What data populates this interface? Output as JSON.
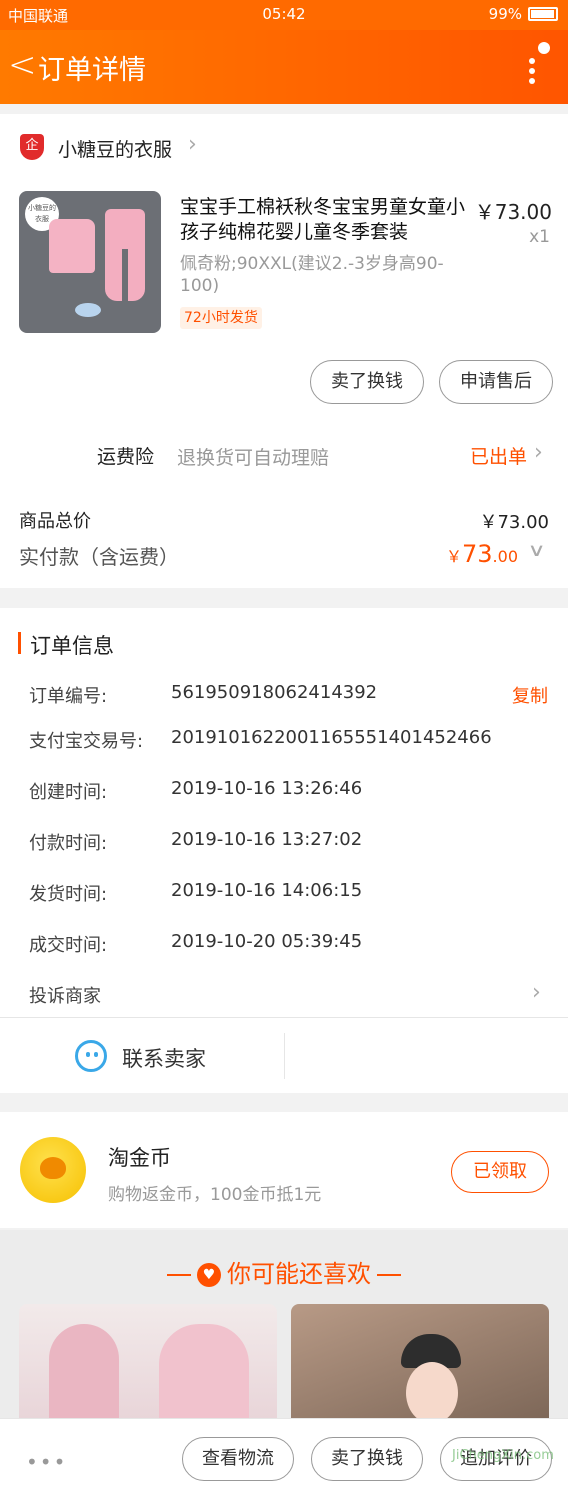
{
  "status_bar": {
    "carrier": "中国联通",
    "time": "05:42",
    "battery": "99%"
  },
  "nav": {
    "title": "订单详情"
  },
  "shop": {
    "badge": "企",
    "name": "小糖豆的衣服"
  },
  "product": {
    "image_tag": "小糖豆的衣服",
    "title": "宝宝手工棉袄秋冬宝宝男童女童小孩子纯棉花婴儿童冬季套装",
    "price": "￥73.00",
    "quantity": "x1",
    "sku": "佩奇粉;90XXL(建议2.-3岁身高90-100)",
    "ship_tag": "72小时发货"
  },
  "product_actions": {
    "sell": "卖了换钱",
    "after_sale": "申请售后"
  },
  "insurance": {
    "label": "运费险",
    "desc": "退换货可自动理赔",
    "status": "已出单"
  },
  "totals": {
    "goods_label": "商品总价",
    "goods_value": "￥73.00",
    "paid_label": "实付款（含运费）",
    "paid_symbol": "￥",
    "paid_int": "73",
    "paid_dec": ".00"
  },
  "order_info": {
    "title": "订单信息",
    "copy": "复制",
    "rows": [
      {
        "k": "订单编号:",
        "v": "561950918062414392"
      },
      {
        "k": "支付宝交易号:",
        "v": "2019101622001165551401452466"
      },
      {
        "k": "创建时间:",
        "v": "2019-10-16 13:26:46"
      },
      {
        "k": "付款时间:",
        "v": "2019-10-16 13:27:02"
      },
      {
        "k": "发货时间:",
        "v": "2019-10-16 14:06:15"
      },
      {
        "k": "成交时间:",
        "v": "2019-10-20 05:39:45"
      }
    ],
    "complain": "投诉商家"
  },
  "contact": {
    "label": "联系卖家"
  },
  "coin": {
    "title": "淘金币",
    "desc": "购物返金币，100金币抵1元",
    "button": "已领取"
  },
  "recommend": {
    "title": "你可能还喜欢"
  },
  "bottom_bar": {
    "more": "•••",
    "logistics": "查看物流",
    "sell": "卖了换钱",
    "review": "追加评价"
  },
  "watermark": "JiChengXin.com"
}
